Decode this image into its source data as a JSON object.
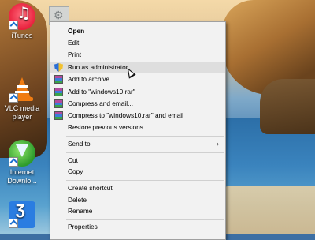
{
  "desktop": {
    "icons": [
      {
        "label": "iTunes"
      },
      {
        "label": "VLC media player"
      },
      {
        "label": "Internet Downlo..."
      },
      {
        "label": ""
      }
    ]
  },
  "context_menu": {
    "items": [
      {
        "label": "Open"
      },
      {
        "label": "Edit"
      },
      {
        "label": "Print"
      },
      {
        "label": "Run as administrator"
      },
      {
        "label": "Add to archive..."
      },
      {
        "label": "Add to \"windows10.rar\""
      },
      {
        "label": "Compress and email..."
      },
      {
        "label": "Compress to \"windows10.rar\" and email"
      },
      {
        "label": "Restore previous versions"
      },
      {
        "label": "Send to"
      },
      {
        "label": "Cut"
      },
      {
        "label": "Copy"
      },
      {
        "label": "Create shortcut"
      },
      {
        "label": "Delete"
      },
      {
        "label": "Rename"
      },
      {
        "label": "Properties"
      }
    ],
    "submenu_arrow": "›",
    "highlighted": "Run as administrator"
  },
  "colors": {
    "menu_bg": "#f2f2f2",
    "highlight": "#dedede",
    "separator": "#d0d0d0"
  },
  "icons": {
    "run_as": "shield-icon",
    "archive": "winrar-icon"
  }
}
